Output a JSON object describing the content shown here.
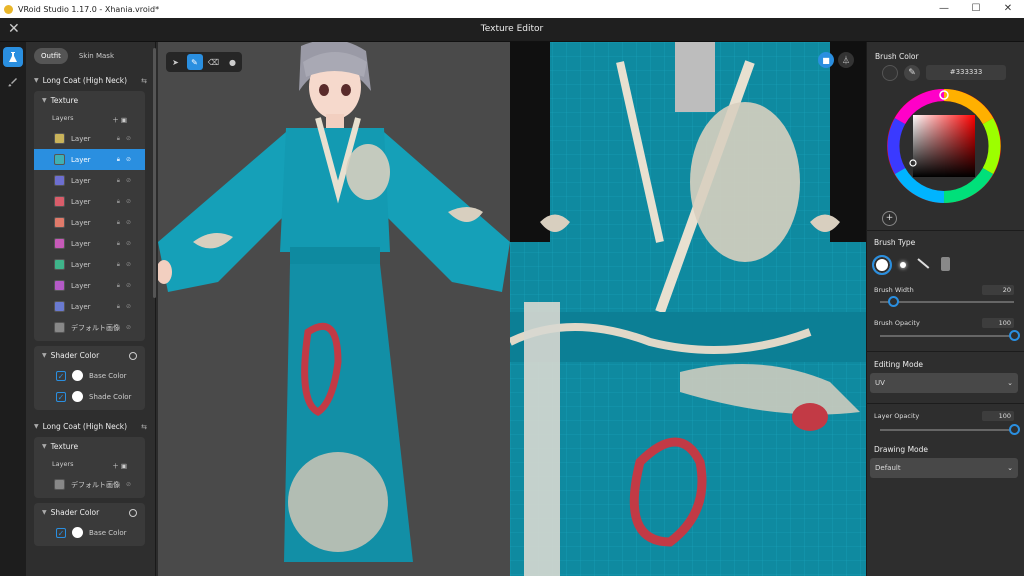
{
  "window": {
    "title": "VRoid Studio 1.17.0 - Xhania.vroid*",
    "controls": [
      "—",
      "☐",
      "✕"
    ]
  },
  "app_bar": {
    "close_icon": "✕",
    "title": "Texture Editor"
  },
  "left_panel": {
    "tabs": [
      {
        "label": "Outfit",
        "active": true
      },
      {
        "label": "Skin Mask",
        "active": false
      }
    ],
    "groups": [
      {
        "name": "Long Coat (High Neck)",
        "texture_title": "Texture",
        "layers_label": "Layers",
        "layers": [
          {
            "label": "Layer",
            "thumb": "#c9b35a",
            "selected": false
          },
          {
            "label": "Layer",
            "thumb": "#3fb0b4",
            "selected": true
          },
          {
            "label": "Layer",
            "thumb": "#6d6fd0",
            "selected": false
          },
          {
            "label": "Layer",
            "thumb": "#d95d6a",
            "selected": false
          },
          {
            "label": "Layer",
            "thumb": "#e07a6a",
            "selected": false
          },
          {
            "label": "Layer",
            "thumb": "#c65ab8",
            "selected": false
          },
          {
            "label": "Layer",
            "thumb": "#3fb48a",
            "selected": false
          },
          {
            "label": "Layer",
            "thumb": "#b45ac6",
            "selected": false
          },
          {
            "label": "Layer",
            "thumb": "#6a7ad0",
            "selected": false
          },
          {
            "label": "デフォルト画像",
            "thumb": "#888888",
            "selected": false
          }
        ],
        "shader_title": "Shader Color",
        "shader_rows": [
          {
            "label": "Base Color"
          },
          {
            "label": "Shade Color"
          }
        ]
      },
      {
        "name": "Long Coat (High Neck)",
        "texture_title": "Texture",
        "layers_label": "Layers",
        "layers": [
          {
            "label": "デフォルト画像",
            "thumb": "#888888",
            "selected": false
          }
        ],
        "shader_title": "Shader Color",
        "shader_rows": [
          {
            "label": "Base Color"
          }
        ]
      }
    ]
  },
  "toolbar": {
    "tools": [
      "select-tool",
      "brush-tool",
      "eraser-tool",
      "fill-tool"
    ],
    "active_tool": "brush-tool"
  },
  "right_panel": {
    "brush_color_title": "Brush Color",
    "hex_value": "#333333",
    "current_color": "#333333",
    "add_swatch": "+",
    "brush_type_title": "Brush Type",
    "brush_width_label": "Brush Width",
    "brush_width_value": "20",
    "brush_width_fraction": 0.1,
    "brush_opacity_label": "Brush Opacity",
    "brush_opacity_value": "100",
    "brush_opacity_fraction": 1.0,
    "editing_mode_title": "Editing Mode",
    "editing_mode_value": "UV",
    "layer_opacity_label": "Layer Opacity",
    "layer_opacity_value": "100",
    "layer_opacity_fraction": 1.0,
    "drawing_mode_title": "Drawing Mode",
    "drawing_mode_value": "Default"
  },
  "colors": {
    "accent": "#2a8fe0",
    "teal_fabric": "#0f8aa0"
  }
}
